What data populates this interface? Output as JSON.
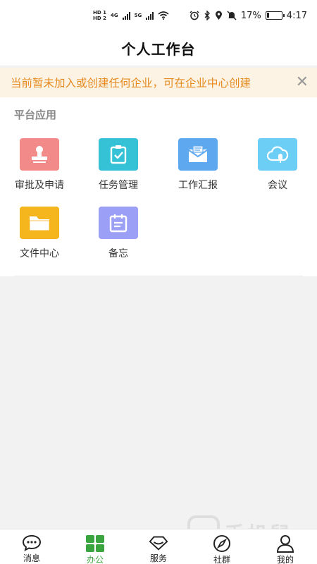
{
  "status_bar": {
    "hd1": "HD 1",
    "hd2": "HD 2",
    "net1": "4G",
    "net2": "5G",
    "battery_percent": "17%",
    "battery_level": 0.17,
    "time": "4:17"
  },
  "header": {
    "title": "个人工作台"
  },
  "notice": {
    "text": "当前暂未加入或创建任何企业，可在企业中心创建",
    "close_icon": "close-icon"
  },
  "apps": {
    "section_title": "平台应用",
    "items": [
      {
        "label": "审批及申请",
        "icon": "stamp-icon",
        "color": "#f28a8a"
      },
      {
        "label": "任务管理",
        "icon": "clipboard-check-icon",
        "color": "#35c1d6"
      },
      {
        "label": "工作汇报",
        "icon": "envelope-icon",
        "color": "#5ea8ef"
      },
      {
        "label": "会议",
        "icon": "cloud-mic-icon",
        "color": "#6ccdf5"
      },
      {
        "label": "文件中心",
        "icon": "folder-icon",
        "color": "#f5b51d"
      },
      {
        "label": "备忘",
        "icon": "calendar-note-icon",
        "color": "#9b9ff5"
      }
    ]
  },
  "tab_bar": {
    "active_color": "#3aa53e",
    "items": [
      {
        "label": "消息",
        "icon": "chat-bubble-icon",
        "active": false
      },
      {
        "label": "办公",
        "icon": "grid-icon",
        "active": true
      },
      {
        "label": "服务",
        "icon": "diamond-icon",
        "active": false
      },
      {
        "label": "社群",
        "icon": "compass-icon",
        "active": false
      },
      {
        "label": "我的",
        "icon": "person-icon",
        "active": false
      }
    ]
  },
  "watermark": {
    "text": "手机鼠"
  }
}
